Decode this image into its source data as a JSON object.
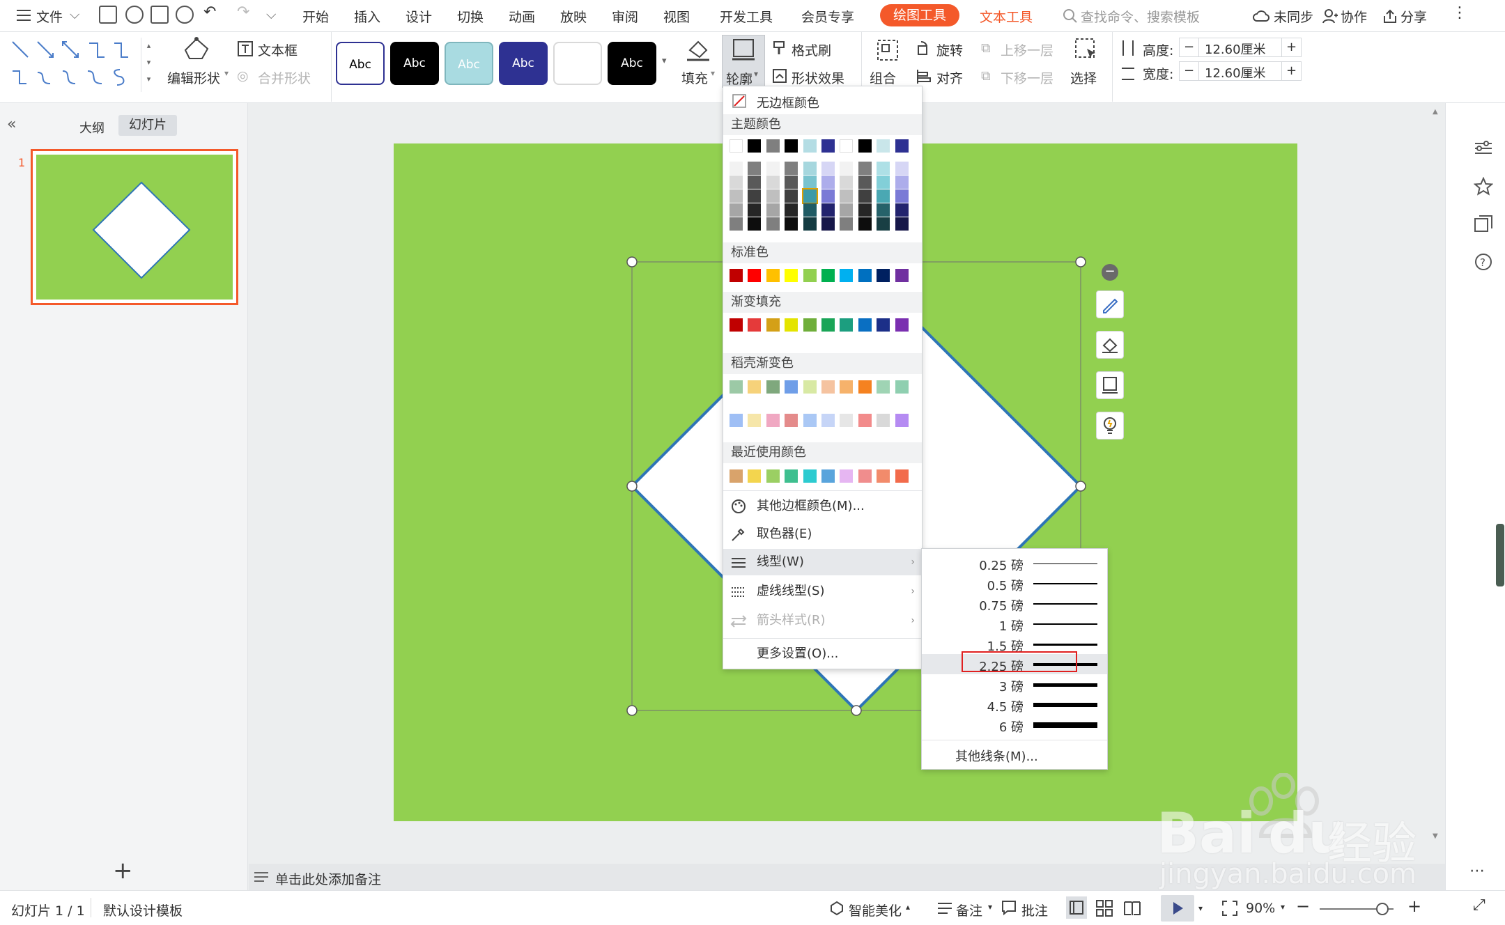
{
  "menubar": {
    "file": "文件",
    "tabs": [
      "开始",
      "插入",
      "设计",
      "切换",
      "动画",
      "放映",
      "审阅",
      "视图",
      "开发工具",
      "会员专享"
    ],
    "active_tab": "绘图工具",
    "text_tools": "文本工具",
    "search": "查找命令、搜索模板",
    "sync": "未同步",
    "collab": "协作",
    "share": "分享",
    "accent": "#f4592a"
  },
  "ribbon": {
    "edit_shape": "编辑形状",
    "textbox": "文本框",
    "merge_shape": "合并形状",
    "styles": [
      "Abc",
      "Abc",
      "Abc",
      "Abc",
      "",
      "Abc"
    ],
    "fill": "填充",
    "outline": "轮廓",
    "format_painter": "格式刷",
    "shape_effect": "形状效果",
    "group": "组合",
    "rotate": "旋转",
    "align": "对齐",
    "bring_forward": "上移一层",
    "send_backward": "下移一层",
    "select": "选择",
    "height_label": "高度:",
    "height_value": "12.60厘米",
    "width_label": "宽度:",
    "width_value": "12.60厘米"
  },
  "left_panel": {
    "outline_tab": "大纲",
    "slides_tab": "幻灯片",
    "slide_number": "1"
  },
  "slide": {
    "background": "#92d050",
    "shape_stroke": "#2e75b6"
  },
  "notes": {
    "placeholder": "单击此处添加备注"
  },
  "status": {
    "slide_info": "幻灯片 1 / 1",
    "template": "默认设计模板",
    "beautify": "智能美化",
    "notes": "备注",
    "comment": "批注",
    "zoom": "90%"
  },
  "outline_menu": {
    "no_border": "无边框颜色",
    "theme_colors": "主题颜色",
    "theme_top": [
      "#ffffff",
      "#000000",
      "#7f7f7f",
      "#000000",
      "#b4dde4",
      "#2e3192",
      "#ffffff",
      "#000000",
      "#c9e6ea",
      "#2e3192"
    ],
    "theme_grid": [
      [
        "#f2f2f2",
        "#7f7f7f",
        "#f2f2f2",
        "#7f7f7f",
        "#a6d7de",
        "#d6d6f5",
        "#f2f2f2",
        "#7f7f7f",
        "#aee0e6",
        "#d6d6f5"
      ],
      [
        "#d9d9d9",
        "#595959",
        "#d9d9d9",
        "#595959",
        "#79c3ce",
        "#adadeb",
        "#d9d9d9",
        "#595959",
        "#82cfd8",
        "#adadeb"
      ],
      [
        "#bfbfbf",
        "#404040",
        "#bfbfbf",
        "#404040",
        "#3d9aa8",
        "#7a7ad6",
        "#bfbfbf",
        "#404040",
        "#4aa8b3",
        "#7a7ad6"
      ],
      [
        "#a6a6a6",
        "#262626",
        "#a6a6a6",
        "#262626",
        "#1f5b64",
        "#22236e",
        "#a6a6a6",
        "#262626",
        "#26626a",
        "#22236e"
      ],
      [
        "#7f7f7f",
        "#0d0d0d",
        "#7f7f7f",
        "#0d0d0d",
        "#143c42",
        "#161749",
        "#7f7f7f",
        "#0d0d0d",
        "#193f44",
        "#161749"
      ]
    ],
    "standard_colors_label": "标准色",
    "standard": [
      "#c00000",
      "#ff0000",
      "#ffc000",
      "#ffff00",
      "#92d050",
      "#00b050",
      "#00b0f0",
      "#0070c0",
      "#002060",
      "#7030a0"
    ],
    "gradient_label": "渐变填充",
    "gradient": [
      "#c00000",
      "#e53a3a",
      "#d4a017",
      "#e4e400",
      "#6fae3a",
      "#1aa557",
      "#1c9e7f",
      "#0a6fc2",
      "#1c2f88",
      "#7a2fb0"
    ],
    "shell_gradient_label": "稻壳渐变色",
    "shell1": [
      "#9cc9a6",
      "#f6d27a",
      "#7fa87d",
      "#6f9ee8",
      "#d8e9a4",
      "#f5c3a0",
      "#f6b26b",
      "#f58220",
      "#9fd4b4",
      "#8fcfb0"
    ],
    "shell2": [
      "#9fbff5",
      "#f6e6a9",
      "#f0a8c2",
      "#e48b8b",
      "#aac8f5",
      "#c6d5f7",
      "#e6e6e6",
      "#f28b8b",
      "#d9d9d9",
      "#b58bf2"
    ],
    "recent_label": "最近使用颜色",
    "recent": [
      "#d9a36b",
      "#f3d54e",
      "#9bcf63",
      "#3ebf8f",
      "#2ccbd0",
      "#59a4dc",
      "#e6b6f2",
      "#f08d8d",
      "#f28b6b",
      "#f26b4b"
    ],
    "more_colors": "其他边框颜色(M)...",
    "eyedropper": "取色器(E)",
    "line_style": "线型(W)",
    "dash_style": "虚线线型(S)",
    "arrow_style": "箭头样式(R)",
    "more_settings": "更多设置(O)..."
  },
  "line_submenu": {
    "items": [
      "0.25 磅",
      "0.5 磅",
      "0.75 磅",
      "1 磅",
      "1.5 磅",
      "2.25 磅",
      "3 磅",
      "4.5 磅",
      "6 磅"
    ],
    "selected": "2.25 磅",
    "more": "其他线条(M)..."
  },
  "watermark": {
    "brand": "Bai",
    "brand2": "du",
    "suffix": "经验",
    "url": "jingyan.baidu.com"
  }
}
